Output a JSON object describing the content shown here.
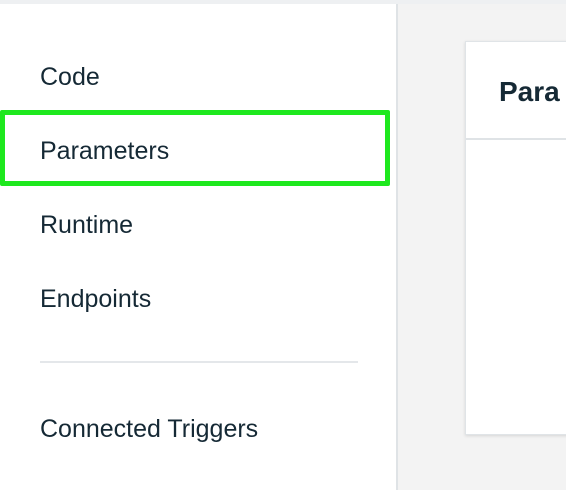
{
  "sidebar": {
    "items": [
      {
        "label": "Code"
      },
      {
        "label": "Parameters",
        "selected": true
      },
      {
        "label": "Runtime"
      },
      {
        "label": "Endpoints"
      },
      {
        "label": "Connected Triggers"
      }
    ]
  },
  "main": {
    "card_title": "Para"
  },
  "colors": {
    "highlight": "#1ee81e",
    "text": "#152935"
  }
}
